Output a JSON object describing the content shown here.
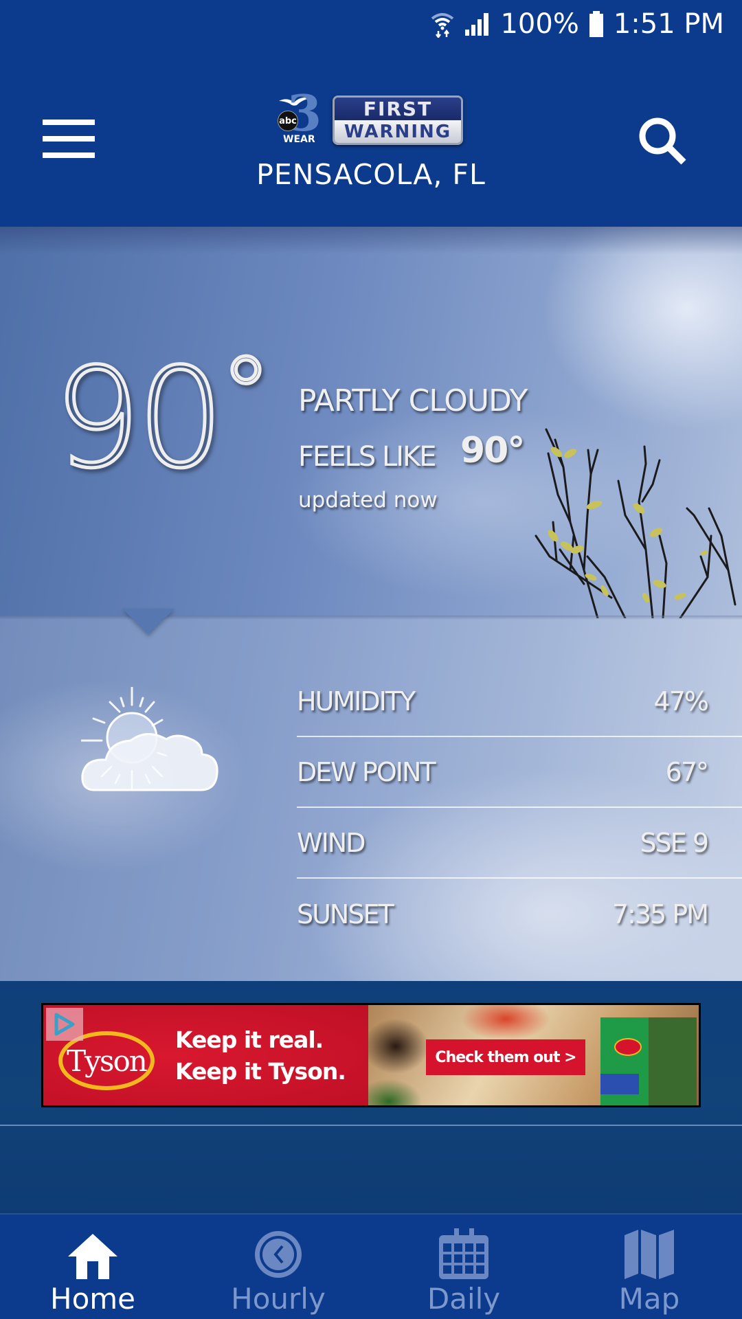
{
  "status_bar": {
    "wifi_icon": "wifi-data-icon",
    "signal_icon": "cell-signal-icon",
    "battery_percent": "100%",
    "battery_icon": "battery-full-icon",
    "time": "1:51 PM"
  },
  "header": {
    "menu_icon": "hamburger-menu-icon",
    "search_icon": "search-icon",
    "logo": {
      "network": "abc",
      "channel": "3",
      "station": "WEAR",
      "badge_top": "FIRST",
      "badge_bottom": "WARNING"
    },
    "location": "PENSACOLA, FL"
  },
  "current": {
    "temperature": "90",
    "degree_symbol": "°",
    "condition": "PARTLY CLOUDY",
    "feels_like_label": "FEELS LIKE",
    "feels_like_value": "90°",
    "updated": "updated now",
    "condition_icon": "partly-cloudy-icon"
  },
  "details": [
    {
      "label": "HUMIDITY",
      "value": "47%"
    },
    {
      "label": "DEW POINT",
      "value": "67°"
    },
    {
      "label": "WIND",
      "value": "SSE 9"
    },
    {
      "label": "SUNSET",
      "value": "7:35 PM"
    }
  ],
  "ad": {
    "brand": "Tyson",
    "tagline_line1": "Keep it real.",
    "tagline_line2": "Keep it Tyson.",
    "cta": "Check them out >",
    "adchoices_icon": "adchoices-icon"
  },
  "bottom_nav": {
    "items": [
      {
        "label": "Home",
        "icon": "home-icon",
        "active": true
      },
      {
        "label": "Hourly",
        "icon": "clock-icon",
        "active": false
      },
      {
        "label": "Daily",
        "icon": "calendar-icon",
        "active": false
      },
      {
        "label": "Map",
        "icon": "map-icon",
        "active": false
      }
    ]
  },
  "colors": {
    "brand_blue": "#0c3a8c",
    "inactive_nav": "#7d98cc",
    "active_nav": "#ffffff",
    "ad_red": "#d5132d"
  }
}
